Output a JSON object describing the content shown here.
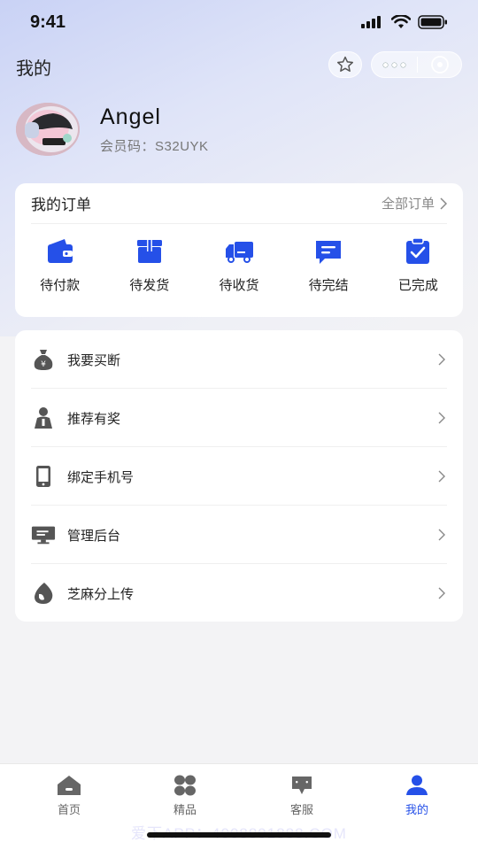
{
  "status_bar": {
    "time": "9:41"
  },
  "nav": {
    "title": "我的"
  },
  "profile": {
    "name": "Angel",
    "member_code": "会员码：S32UYK"
  },
  "orders": {
    "title": "我的订单",
    "all_label": "全部订单",
    "items": [
      {
        "label": "待付款",
        "icon": "wallet-icon"
      },
      {
        "label": "待发货",
        "icon": "package-icon"
      },
      {
        "label": "待收货",
        "icon": "truck-icon"
      },
      {
        "label": "待完结",
        "icon": "message-icon"
      },
      {
        "label": "已完成",
        "icon": "clipboard-check-icon"
      }
    ]
  },
  "menu": {
    "items": [
      {
        "label": "我要买断",
        "icon": "money-bag-icon"
      },
      {
        "label": "推荐有奖",
        "icon": "person-icon"
      },
      {
        "label": "绑定手机号",
        "icon": "phone-icon"
      },
      {
        "label": "管理后台",
        "icon": "monitor-icon"
      },
      {
        "label": "芝麻分上传",
        "icon": "sesame-icon"
      }
    ]
  },
  "tabs": [
    {
      "label": "首页",
      "icon": "home-icon",
      "active": false
    },
    {
      "label": "精品",
      "icon": "grid-icon",
      "active": false
    },
    {
      "label": "客服",
      "icon": "chat-icon",
      "active": false
    },
    {
      "label": "我的",
      "icon": "user-icon",
      "active": true
    }
  ],
  "watermark": "爱下APP：4008891888.COM",
  "colors": {
    "accent": "#2550e8",
    "icon_gray": "#555555"
  }
}
